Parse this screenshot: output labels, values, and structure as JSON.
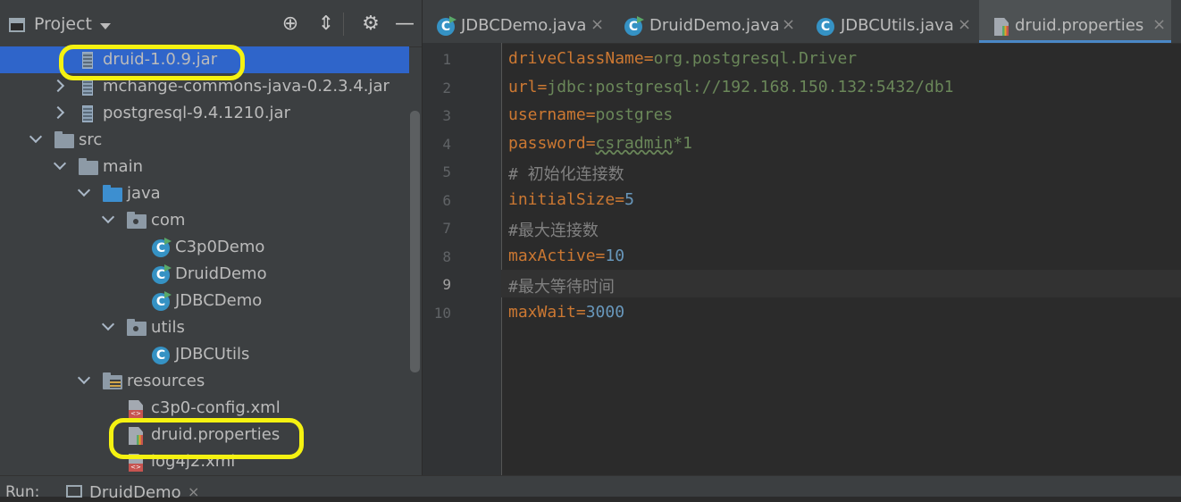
{
  "project": {
    "title": "Project",
    "tools": {
      "locate": "⊕",
      "collapse": "⇕",
      "settings": "⚙",
      "hide": "—"
    },
    "tree": [
      {
        "label": "druid-1.0.9.jar",
        "icon": "jar-icon",
        "selected": true
      },
      {
        "label": "mchange-commons-java-0.2.3.4.jar",
        "icon": "jar-icon"
      },
      {
        "label": "postgresql-9.4.1210.jar",
        "icon": "jar-icon"
      },
      {
        "label": "src",
        "icon": "folder-icon"
      },
      {
        "label": "main",
        "icon": "folder-icon"
      },
      {
        "label": "java",
        "icon": "source-folder-icon"
      },
      {
        "label": "com",
        "icon": "package-icon"
      },
      {
        "label": "C3p0Demo",
        "icon": "java-class-icon"
      },
      {
        "label": "DruidDemo",
        "icon": "java-class-icon"
      },
      {
        "label": "JDBCDemo",
        "icon": "java-class-icon"
      },
      {
        "label": "utils",
        "icon": "package-icon"
      },
      {
        "label": "JDBCUtils",
        "icon": "java-class-icon"
      },
      {
        "label": "resources",
        "icon": "resources-folder-icon"
      },
      {
        "label": "c3p0-config.xml",
        "icon": "xml-file-icon"
      },
      {
        "label": "druid.properties",
        "icon": "properties-file-icon"
      },
      {
        "label": "log4j2.xml",
        "icon": "xml-file-icon"
      }
    ]
  },
  "editor": {
    "tabs": [
      {
        "label": "JDBCDemo.java",
        "close": "×"
      },
      {
        "label": "DruidDemo.java",
        "close": "×"
      },
      {
        "label": "JDBCUtils.java",
        "close": "×"
      },
      {
        "label": "druid.properties",
        "close": "×",
        "active": true
      }
    ],
    "line_numbers": [
      "1",
      "2",
      "3",
      "4",
      "5",
      "6",
      "7",
      "8",
      "9",
      "10"
    ],
    "current_line": 9,
    "lines": [
      {
        "key": "driveClassName",
        "eq": "=",
        "value": "org.postgresql.Driver"
      },
      {
        "key": "url",
        "eq": "=",
        "value": "jdbc:postgresql://192.168.150.132:5432/db1"
      },
      {
        "key": "username",
        "eq": "=",
        "value": "postgres"
      },
      {
        "key": "password",
        "eq": "=",
        "value": "csradmin",
        "value_extra": "*1"
      },
      {
        "comment": "# 初始化连接数"
      },
      {
        "key": "initialSize",
        "eq": "=",
        "value": "5"
      },
      {
        "comment": "#最大连接数"
      },
      {
        "key": "maxActive",
        "eq": "=",
        "value": "10"
      },
      {
        "comment": "#最大等待时间"
      },
      {
        "key": "maxWait",
        "eq": "=",
        "value": "3000"
      }
    ]
  },
  "bottom": {
    "label": "Run:",
    "tab": "DruidDemo",
    "close": "×"
  },
  "colors": {
    "highlight": "#f5f211",
    "selection": "#2f65ca",
    "keyword": "#cc7832",
    "string": "#6a8759",
    "number": "#6897bb"
  }
}
